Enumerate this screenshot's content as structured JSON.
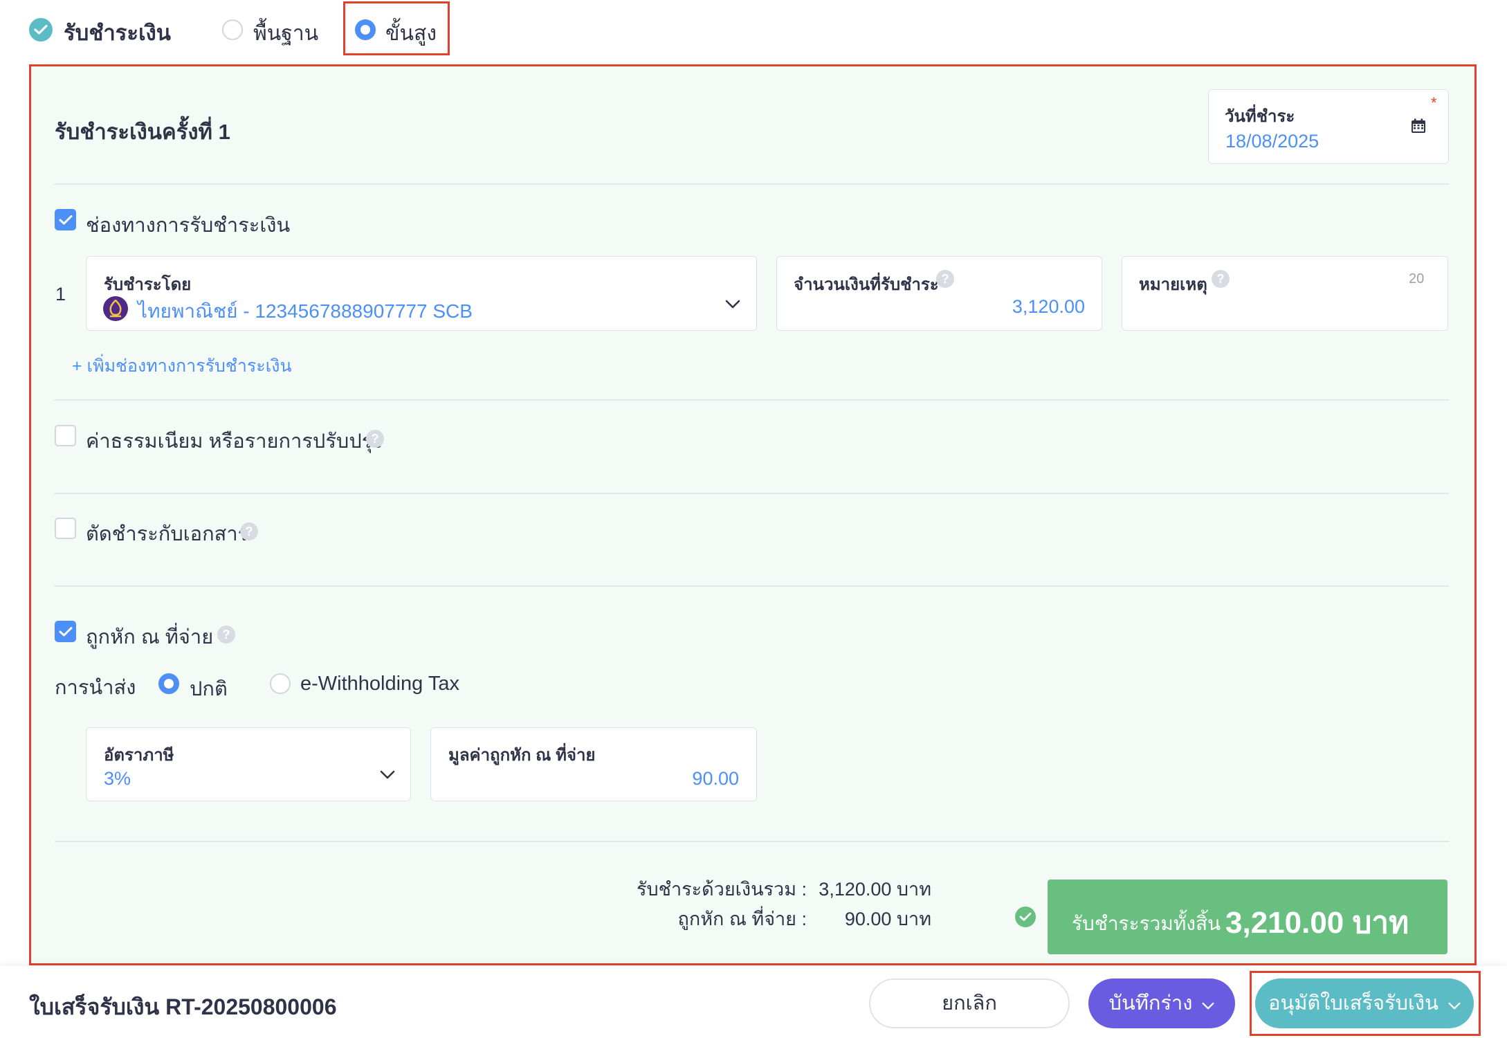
{
  "header": {
    "title": "รับชำระเงิน",
    "mode_basic": "พื้นฐาน",
    "mode_advanced": "ขั้นสูง",
    "selected_mode": "ขั้นสูง"
  },
  "payment": {
    "section_title": "รับชำระเงินครั้งที่ 1",
    "date_label": "วันที่ชำระ",
    "date_value": "18/08/2025",
    "required_mark": "*",
    "channels": {
      "label": "ช่องทางการรับชำระเงิน",
      "checked": true,
      "rows": [
        {
          "index": "1",
          "method_label": "รับชำระโดย",
          "method_value": "ไทยพาณิชย์ - 1234567888907777 SCB",
          "amount_label": "จำนวนเงินที่รับชำระ",
          "amount_value": "3,120.00",
          "note_label": "หมายเหตุ",
          "note_counter": "20"
        }
      ],
      "add_label": "+ เพิ่มช่องทางการรับชำระเงิน"
    },
    "fees": {
      "label": "ค่าธรรมเนียม หรือรายการปรับปรุง",
      "checked": false
    },
    "offset": {
      "label": "ตัดชำระกับเอกสาร",
      "checked": false
    },
    "withholding": {
      "label": "ถูกหัก ณ ที่จ่าย",
      "checked": true,
      "submission_label": "การนำส่ง",
      "option_normal": "ปกติ",
      "option_ewht": "e-Withholding Tax",
      "selected": "ปกติ",
      "rate_label": "อัตราภาษี",
      "rate_value": "3%",
      "amount_label": "มูลค่าถูกหัก ณ ที่จ่าย",
      "amount_value": "90.00"
    },
    "summary": {
      "cash_label": "รับชำระด้วยเงินรวม :",
      "cash_value": "3,120.00 บาท",
      "wht_label": "ถูกหัก ณ ที่จ่าย :",
      "wht_value": "90.00 บาท",
      "total_label": "รับชำระรวมทั้งสิ้น",
      "total_value": "3,210.00 บาท"
    }
  },
  "footer": {
    "document_title": "ใบเสร็จรับเงิน RT-20250800006",
    "cancel_label": "ยกเลิก",
    "draft_label": "บันทึกร่าง",
    "approve_label": "อนุมัติใบเสร็จรับเงิน"
  },
  "colors": {
    "accent_blue": "#4b8ff7",
    "teal": "#5bbcc6",
    "purple": "#6a5ce0",
    "green": "#68bf7f",
    "highlight_red": "#e2412e",
    "panel_bg": "#f4fbf7"
  },
  "icons": {
    "header_status": "check-circle-icon",
    "date": "calendar-icon",
    "dropdown": "chevron-down-icon",
    "help": "question-circle-icon",
    "bank": "scb-bank-logo",
    "summary_status": "check-circle-icon"
  }
}
